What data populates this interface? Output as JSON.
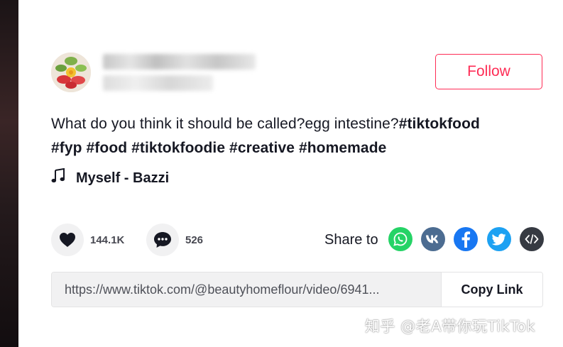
{
  "colors": {
    "accent": "#fe2c55",
    "text": "#161823",
    "whatsapp": "#25d366",
    "vk": "#4c6c91",
    "facebook": "#1877f2",
    "twitter": "#1da1f2",
    "embed": "#363a42"
  },
  "profile": {
    "follow_label": "Follow"
  },
  "caption": {
    "text": "What do you think it should be called?egg intestine?",
    "hashtags": [
      "#tiktokfood",
      "#fyp",
      "#food",
      "#tiktokfoodie",
      "#creative",
      "#homemade"
    ]
  },
  "music": {
    "icon": "music-note-icon",
    "title": "Myself - Bazzi"
  },
  "actions": {
    "likes": "144.1K",
    "comments": "526"
  },
  "share": {
    "label": "Share to",
    "targets": [
      "whatsapp-icon",
      "vk-icon",
      "facebook-icon",
      "twitter-icon",
      "embed-icon"
    ]
  },
  "link": {
    "url": "https://www.tiktok.com/@beautyhomeflour/video/6941...",
    "copy_label": "Copy Link"
  },
  "watermark": "知乎 @老A带你玩TikTok"
}
